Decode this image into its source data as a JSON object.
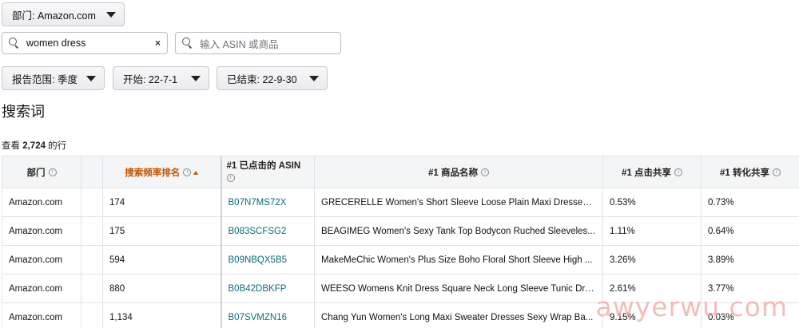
{
  "filters": {
    "department_label": "部门: Amazon.com",
    "search_term_value": "women dress",
    "search_term_clear": "×",
    "asin_placeholder": "输入 ASIN 或商品",
    "report_range_label": "报告范围: 季度",
    "start_label": "开始: 22-7-1",
    "end_label": "已结束: 22-9-30"
  },
  "section_title": "搜索词",
  "row_count": {
    "prefix": "查看 ",
    "count": "2,724",
    "suffix": " 的行"
  },
  "table": {
    "headers": {
      "department": "部门",
      "rank": "搜索频率排名",
      "asin_line1": "#1 已点击的 ASIN",
      "product_name": "#1 商品名称",
      "click_share": "#1 点击共享",
      "conversion_share": "#1 转化共享"
    },
    "info_glyph": "i",
    "rows": [
      {
        "department": "Amazon.com",
        "rank": "174",
        "asin": "B07N7MS72X",
        "product": "GRECERELLE Women's Short Sleeve Loose Plain Maxi Dresses C...",
        "click": "0.53%",
        "conversion": "0.73%"
      },
      {
        "department": "Amazon.com",
        "rank": "175",
        "asin": "B083SCFSG2",
        "product": "BEAGIMEG Women's Sexy Tank Top Bodycon Ruched Sleeveles...",
        "click": "1.11%",
        "conversion": "0.64%"
      },
      {
        "department": "Amazon.com",
        "rank": "594",
        "asin": "B09NBQX5B5",
        "product": "MakeMeChic Women's Plus Size Boho Floral Short Sleeve High ...",
        "click": "3.26%",
        "conversion": "3.89%"
      },
      {
        "department": "Amazon.com",
        "rank": "880",
        "asin": "B0B42DBKFP",
        "product": "WEESO Womens Knit Dress Square Neck Long Sleeve Tunic Dre...",
        "click": "2.61%",
        "conversion": "3.77%"
      },
      {
        "department": "Amazon.com",
        "rank": "1,134",
        "asin": "B07SVMZN16",
        "product": "Chang Yun Women's Long Maxi Sweater Dresses Sexy Wrap Ba...",
        "click": "9.15%",
        "conversion": "0.03%"
      }
    ]
  },
  "watermark": "awyerwu.com",
  "icons": {
    "search": "search-icon",
    "caret": "chevron-down-icon",
    "info": "info-icon",
    "sort": "sort-ascending-icon"
  }
}
